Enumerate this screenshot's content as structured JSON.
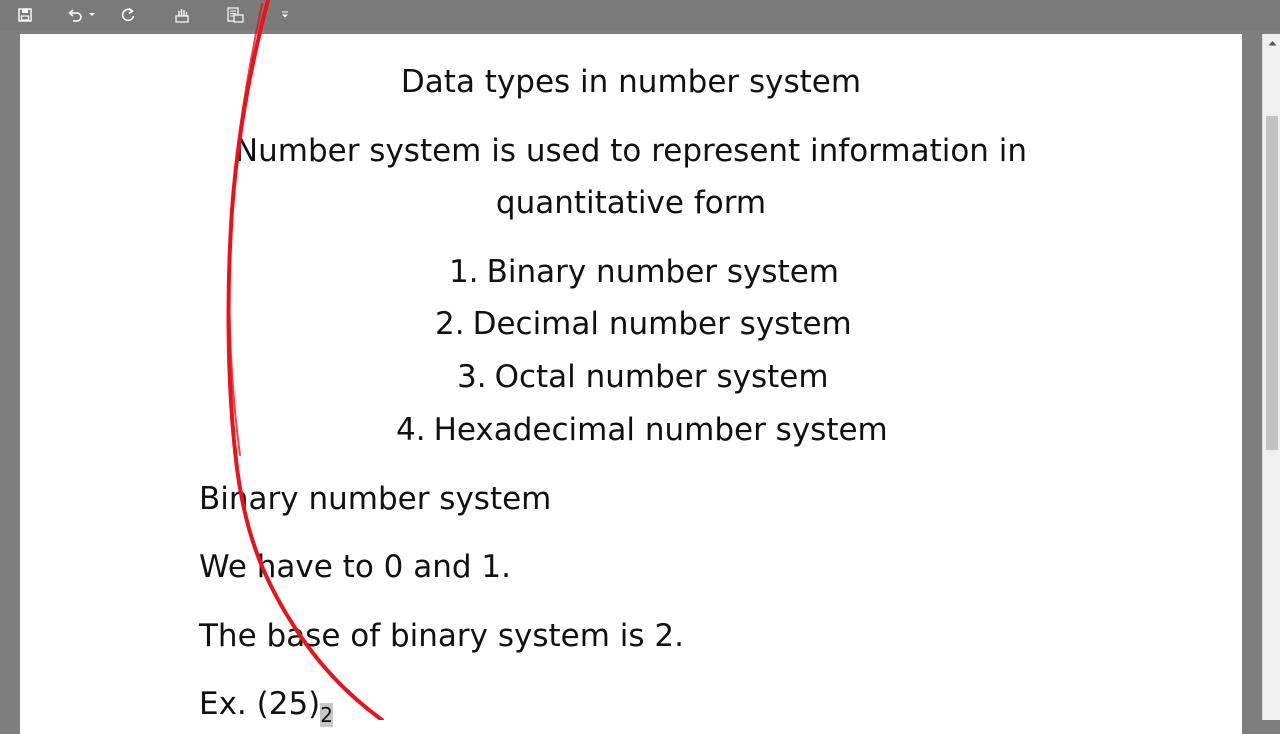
{
  "toolbar": {
    "icons": [
      "save-icon",
      "undo-icon",
      "undo-dropdown-icon",
      "redo-icon",
      "touch-mode-icon",
      "print-preview-icon",
      "customize-dropdown-icon"
    ]
  },
  "document": {
    "title": "Data types in number system",
    "intro_line1": "Number system is used to represent information in",
    "intro_line2": "quantitative form",
    "list": [
      {
        "num": "1.",
        "text": "Binary number system"
      },
      {
        "num": "2.",
        "text": "Decimal number system"
      },
      {
        "num": "3.",
        "text": "Octal number system"
      },
      {
        "num": "4.",
        "text": "Hexadecimal number system"
      }
    ],
    "section_heading": "Binary number system",
    "line_digits": "We have to 0 and 1.",
    "line_base": "The base of binary system is 2.",
    "example_prefix": "Ex. (25)",
    "example_subscript": "2"
  },
  "colors": {
    "ink": "#e8131c",
    "page": "#ffffff",
    "chrome": "#7a7a7a"
  }
}
